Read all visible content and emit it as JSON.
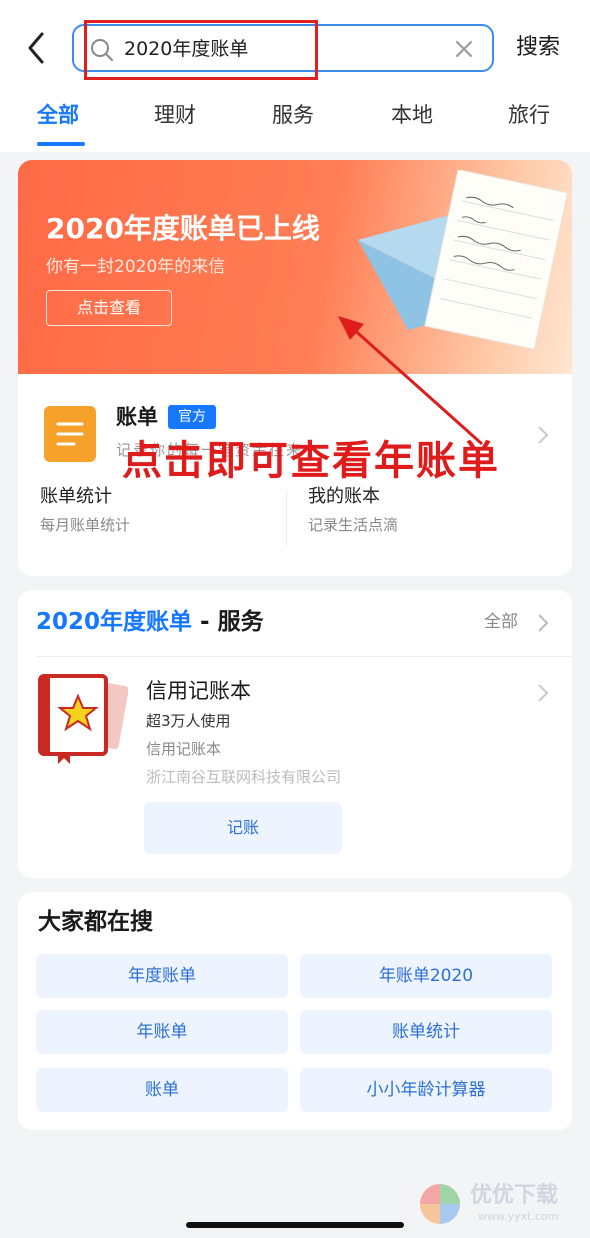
{
  "search": {
    "query": "2020年度账单",
    "submit_label": "搜索"
  },
  "tabs": [
    {
      "label": "全部",
      "active": true
    },
    {
      "label": "理财"
    },
    {
      "label": "服务"
    },
    {
      "label": "本地"
    },
    {
      "label": "旅行"
    }
  ],
  "banner": {
    "title": "2020年度账单已上线",
    "subtitle": "你有一封2020年的来信",
    "button_label": "点击查看"
  },
  "app": {
    "name": "账单",
    "badge": "官方",
    "description": "记录你的每一笔资金往来",
    "features": [
      {
        "title": "账单统计",
        "subtitle": "每月账单统计"
      },
      {
        "title": "我的账本",
        "subtitle": "记录生活点滴"
      }
    ]
  },
  "annotation": {
    "text": "点击即可查看年账单",
    "color": "#e01b1b"
  },
  "service": {
    "heading_highlight": "2020年度账单",
    "heading_rest": " - 服务",
    "all_label": "全部",
    "item": {
      "name": "信用记账本",
      "users": "超3万人使用",
      "app_name": "信用记账本",
      "company": "浙江南谷互联网科技有限公司",
      "action_label": "记账"
    }
  },
  "hot_searches": {
    "title": "大家都在搜",
    "items": [
      "年度账单",
      "年账单2020",
      "年账单",
      "账单统计",
      "账单",
      "小小年龄计算器"
    ]
  },
  "watermark": {
    "brand": "优优下载",
    "url": "www.yyxt.com"
  },
  "colors": {
    "accent": "#1677ff",
    "banner": "#ff6a45"
  }
}
